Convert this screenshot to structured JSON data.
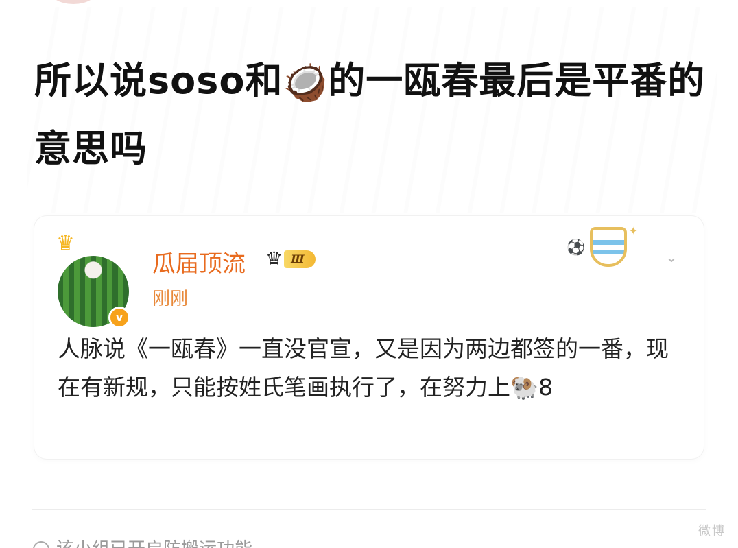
{
  "post": {
    "title_part1": "所以说soso和",
    "title_emoji": "🥥",
    "title_part2": "的一瓯春最后是平番的意思吗"
  },
  "repost": {
    "author": {
      "name": "瓜届顶流",
      "vip_level": "Ⅲ",
      "timestamp": "刚刚",
      "avatar_badge": "v"
    },
    "text": "人脉说《一瓯春》一直没官宣，又是因为两边都签的一番，现在有新规，只能按姓氏笔画执行了，在努力上🐏8"
  },
  "footer": {
    "hint_text": "该小组已开启防搬运功能",
    "watermark": "微博"
  },
  "colors": {
    "username": "#e86b1f",
    "timestamp": "#e8893a",
    "badge": "#f7a21b"
  },
  "icons": [
    "crown-icon",
    "verified-icon",
    "vip-crown-icon",
    "medal-icon",
    "chevron-down-icon",
    "coconut-emoji",
    "sheep-emoji"
  ]
}
